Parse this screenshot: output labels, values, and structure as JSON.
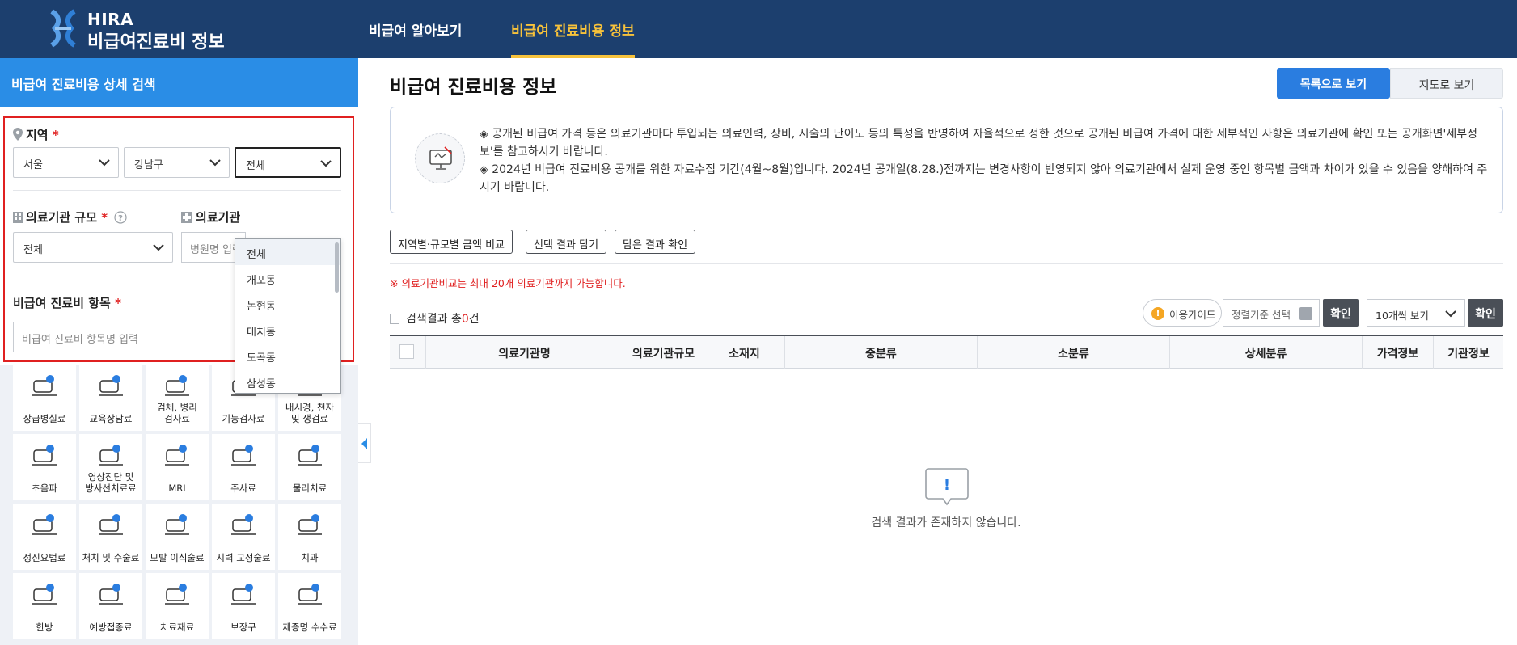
{
  "header": {
    "logo_line1": "HIRA",
    "logo_line2": "비급여진료비 정보",
    "nav": [
      "비급여 알아보기",
      "비급여 진료비용 정보"
    ]
  },
  "sidebar": {
    "title": "비급여 진료비용 상세 검색",
    "region_label": "지역",
    "required_mark": "*",
    "region_sido": "서울",
    "region_sigungu": "강남구",
    "region_dong": "전체",
    "dong_options": [
      "전체",
      "개포동",
      "논현동",
      "대치동",
      "도곡동",
      "삼성동"
    ],
    "scale_label": "의료기관 규모",
    "scale_value": "전체",
    "inst_label": "의료기관",
    "inst_placeholder": "병원명 입력",
    "item_label": "비급여 진료비 항목",
    "item_placeholder": "비급여 진료비 항목명 입력",
    "categories": [
      "상급병실료",
      "교육상담료",
      "검체, 병리\n검사료",
      "기능검사료",
      "내시경, 천자\n및 생검료",
      "초음파",
      "영상진단 및\n방사선치료료",
      "MRI",
      "주사료",
      "물리치료",
      "정신요법료",
      "처치 및 수술료",
      "모발 이식술료",
      "시력 교정술료",
      "치과",
      "한방",
      "예방접종료",
      "치료재료",
      "보장구",
      "제증명 수수료"
    ]
  },
  "main": {
    "title": "비급여 진료비용 정보",
    "view_list": "목록으로 보기",
    "view_map": "지도로 보기",
    "notice1": "◈ 공개된 비급여 가격 등은 의료기관마다 투입되는 의료인력, 장비, 시술의 난이도 등의 특성을 반영하여 자율적으로 정한 것으로 공개된 비급여 가격에 대한 세부적인 사항은 의료기관에 확인 또는 공개화면'세부정보'를 참고하시기 바랍니다.",
    "notice2": "◈ 2024년 비급여 진료비용 공개를 위한 자료수집 기간(4월~8월)입니다. 2024년 공개일(8.28.)전까지는 변경사항이 반영되지 않아 의료기관에서 실제 운영 중인 항목별 금액과 차이가 있을 수 있음을 양해하여 주시기 바랍니다.",
    "actions": [
      "지역별·규모별 금액 비교",
      "선택 결과 담기",
      "담은 결과 확인"
    ],
    "warning": "※ 의료기관비교는 최대 20개 의료기관까지 가능합니다.",
    "result_prefix": "검색결과 총",
    "result_count": "0",
    "result_suffix": "건",
    "guide": "이용가이드",
    "sort_placeholder": "정렬기준 선택",
    "confirm": "확인",
    "per_page": "10개씩 보기",
    "columns": [
      "의료기관명",
      "의료기관규모",
      "소재지",
      "중분류",
      "소분류",
      "상세분류",
      "가격정보",
      "기관정보"
    ],
    "empty_text": "검색 결과가 존재하지 않습니다."
  },
  "colors": {
    "header_bg": "#1c3f6e",
    "nav_active": "#f7c23b",
    "primary_blue": "#2a8de6",
    "highlight_border": "#e02020"
  }
}
